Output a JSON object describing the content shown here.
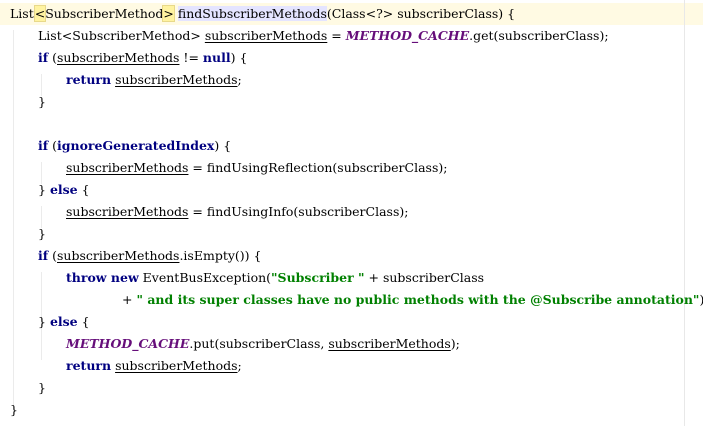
{
  "editor": {
    "language": "java",
    "indent_unit": "    ",
    "colors": {
      "keyword": "#000080",
      "static_field": "#660e7a",
      "string": "#008000",
      "current_line": "#fffae3",
      "method_highlight": "#e4e4ff",
      "type_param_highlight": "#fff3a0"
    },
    "lines": [
      {
        "indent": 0,
        "segments": [
          {
            "t": "List"
          },
          {
            "t": "<",
            "s": "tp"
          },
          {
            "t": "SubscriberMethod"
          },
          {
            "t": ">",
            "s": "tp"
          },
          {
            "t": " "
          },
          {
            "t": "findSubscriberMethods",
            "s": "mth"
          },
          {
            "t": "(Class<?> subscriberClass) {"
          }
        ]
      },
      {
        "indent": 1,
        "segments": [
          {
            "t": "List<SubscriberMethod> "
          },
          {
            "t": "subscriberMethods",
            "s": "var"
          },
          {
            "t": " = "
          },
          {
            "t": "METHOD_CACHE",
            "s": "fld"
          },
          {
            "t": ".get(subscriberClass);"
          }
        ]
      },
      {
        "indent": 1,
        "segments": [
          {
            "t": "if",
            "s": "kw"
          },
          {
            "t": " ("
          },
          {
            "t": "subscriberMethods",
            "s": "var"
          },
          {
            "t": " != "
          },
          {
            "t": "null",
            "s": "kw"
          },
          {
            "t": ") {"
          }
        ]
      },
      {
        "indent": 2,
        "segments": [
          {
            "t": "return",
            "s": "kw"
          },
          {
            "t": " "
          },
          {
            "t": "subscriberMethods",
            "s": "var"
          },
          {
            "t": ";"
          }
        ]
      },
      {
        "indent": 1,
        "segments": [
          {
            "t": "}"
          }
        ]
      },
      {
        "indent": 0,
        "segments": []
      },
      {
        "indent": 1,
        "segments": [
          {
            "t": "if",
            "s": "kw"
          },
          {
            "t": " ("
          },
          {
            "t": "ignoreGeneratedIndex",
            "s": "kw"
          },
          {
            "t": ") {"
          }
        ]
      },
      {
        "indent": 2,
        "segments": [
          {
            "t": "subscriberMethods",
            "s": "var"
          },
          {
            "t": " = findUsingReflection(subscriberClass);"
          }
        ]
      },
      {
        "indent": 1,
        "segments": [
          {
            "t": "} "
          },
          {
            "t": "else",
            "s": "kw"
          },
          {
            "t": " {"
          }
        ]
      },
      {
        "indent": 2,
        "segments": [
          {
            "t": "subscriberMethods",
            "s": "var"
          },
          {
            "t": " = findUsingInfo(subscriberClass);"
          }
        ]
      },
      {
        "indent": 1,
        "segments": [
          {
            "t": "}"
          }
        ]
      },
      {
        "indent": 1,
        "segments": [
          {
            "t": "if",
            "s": "kw"
          },
          {
            "t": " ("
          },
          {
            "t": "subscriberMethods",
            "s": "var"
          },
          {
            "t": ".isEmpty()) {"
          }
        ]
      },
      {
        "indent": 2,
        "segments": [
          {
            "t": "throw new",
            "s": "kw"
          },
          {
            "t": " EventBusException("
          },
          {
            "t": "\"Subscriber \"",
            "s": "str"
          },
          {
            "t": " + subscriberClass"
          }
        ]
      },
      {
        "indent": 4,
        "segments": [
          {
            "t": "+ "
          },
          {
            "t": "\" and its super classes have no public methods with the @Subscribe annotation\"",
            "s": "str"
          },
          {
            "t": ");"
          }
        ]
      },
      {
        "indent": 1,
        "segments": [
          {
            "t": "} "
          },
          {
            "t": "else",
            "s": "kw"
          },
          {
            "t": " {"
          }
        ]
      },
      {
        "indent": 2,
        "segments": [
          {
            "t": "METHOD_CACHE",
            "s": "fld"
          },
          {
            "t": ".put(subscriberClass, "
          },
          {
            "t": "subscriberMethods",
            "s": "var"
          },
          {
            "t": ");"
          }
        ]
      },
      {
        "indent": 2,
        "segments": [
          {
            "t": "return",
            "s": "kw"
          },
          {
            "t": " "
          },
          {
            "t": "subscriberMethods",
            "s": "var"
          },
          {
            "t": ";"
          }
        ]
      },
      {
        "indent": 1,
        "segments": [
          {
            "t": "}"
          }
        ]
      },
      {
        "indent": 0,
        "segments": [
          {
            "t": "}"
          }
        ]
      }
    ]
  }
}
